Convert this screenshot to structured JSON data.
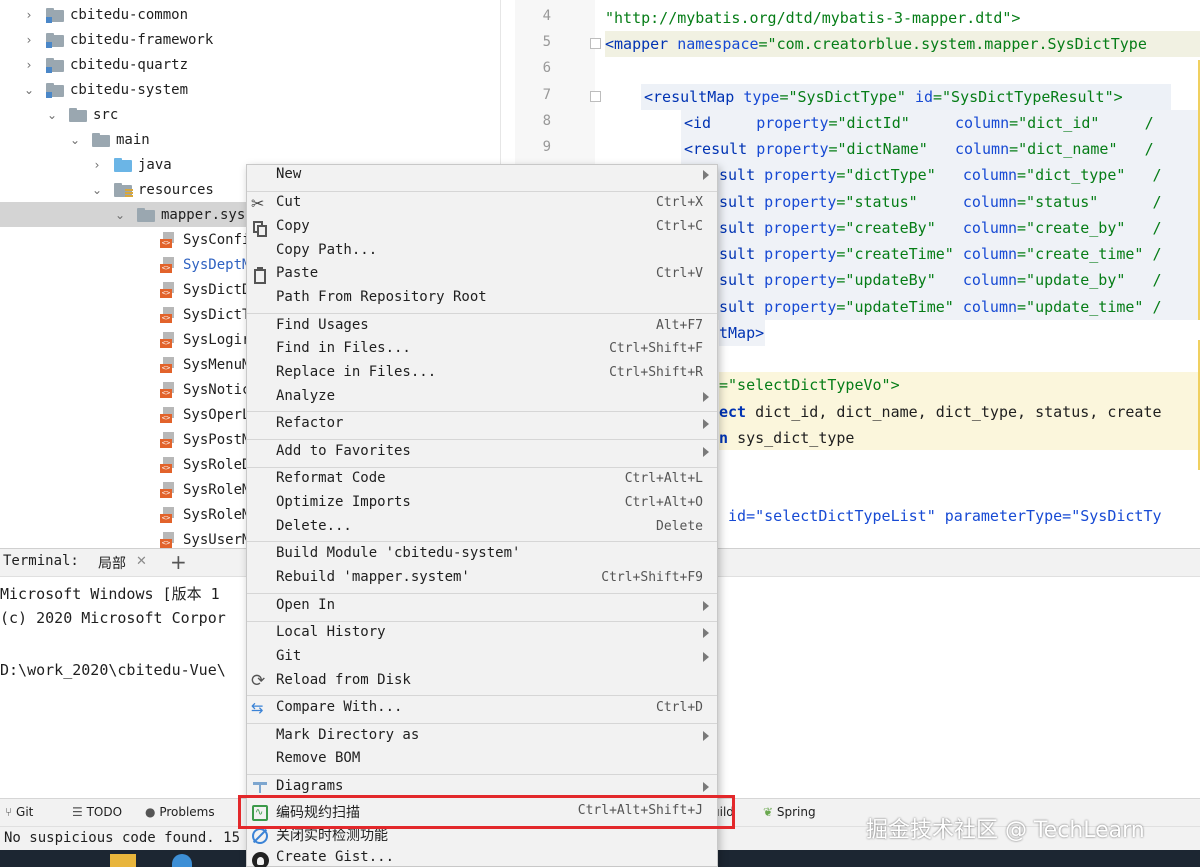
{
  "tree": {
    "items": [
      {
        "label": "cbitedu-common",
        "kind": "module",
        "expanded": false
      },
      {
        "label": "cbitedu-framework",
        "kind": "module",
        "expanded": false
      },
      {
        "label": "cbitedu-quartz",
        "kind": "module",
        "expanded": false
      },
      {
        "label": "cbitedu-system",
        "kind": "module",
        "expanded": true
      },
      {
        "label": "src",
        "kind": "folder",
        "expanded": true
      },
      {
        "label": "main",
        "kind": "folder",
        "expanded": true
      },
      {
        "label": "java",
        "kind": "source",
        "expanded": false
      },
      {
        "label": "resources",
        "kind": "resources",
        "expanded": true
      },
      {
        "label": "mapper.syst",
        "kind": "folder",
        "expanded": true
      },
      {
        "label": "SysConfi"
      },
      {
        "label": "SysDeptM"
      },
      {
        "label": "SysDictD"
      },
      {
        "label": "SysDictT"
      },
      {
        "label": "SysLogir"
      },
      {
        "label": "SysMenuM"
      },
      {
        "label": "SysNotic"
      },
      {
        "label": "SysOperL"
      },
      {
        "label": "SysPostM"
      },
      {
        "label": "SysRoleD"
      },
      {
        "label": "SysRoleM"
      },
      {
        "label": "SysRoleM"
      },
      {
        "label": "SysUserM"
      }
    ]
  },
  "editor": {
    "line_numbers": [
      "4",
      "5",
      "6",
      "7",
      "8",
      "9"
    ],
    "lines": {
      "l4": "\"http://mybatis.org/dtd/mybatis-3-mapper.dtd\">",
      "l5a": "<mapper ",
      "l5b": "namespace",
      "l5c": "=\"com.creatorblue.system.mapper.SysDictType",
      "l7a": "<resultMap ",
      "l7b": "type",
      "l7c": "=\"SysDictType\" ",
      "l7d": "id",
      "l7e": "=\"SysDictTypeResult\">",
      "l8a": "<id     ",
      "l8b": "property",
      "l8c": "=\"dictId\"     ",
      "l8d": "column",
      "l8e": "=\"dict_id\"     /",
      "l9a": "<result ",
      "l9b": "property",
      "l9c": "=\"dictName\"   ",
      "l9d": "column",
      "l9e": "=\"dict_name\"   /",
      "r3a": "sult ",
      "r3b": "property",
      "r3c": "=\"dictType\"   ",
      "r3d": "column",
      "r3e": "=\"dict_type\"   /",
      "r4c": "=\"status\"     ",
      "r4e": "=\"status\"      /",
      "r5c": "=\"createBy\"   ",
      "r5e": "=\"create_by\"   /",
      "r6c": "=\"createTime\" ",
      "r6e": "=\"create_time\" /",
      "r7c": "=\"updateBy\"   ",
      "r7e": "=\"update_by\"   /",
      "r8c": "=\"updateTime\" ",
      "r8e": "=\"update_time\" /",
      "end_map": "tMap>",
      "sql_id": "=\"selectDictTypeVo\">",
      "sel_kw": "ect ",
      "sel_rest": "dict_id, dict_name, dict_type, status, create",
      "from_kw": "n ",
      "from_rest": "sys_dict_type",
      "partial": " id=\"selectDictTypeList\" parameterType=\"SysDictTy"
    }
  },
  "terminal": {
    "title": "Terminal:",
    "tab": "局部",
    "lines": [
      "Microsoft Windows [版本 1",
      "(c) 2020 Microsoft Corpor",
      "",
      "D:\\work_2020\\cbitedu-Vue\\"
    ]
  },
  "toolbar": {
    "git": "Git",
    "todo": "TODO",
    "problems": "Problems",
    "build_partial": "uild",
    "spring": "Spring"
  },
  "statusbar": {
    "message": "No suspicious code found. 15 f"
  },
  "watermark": "掘金技术社区 @ TechLearn",
  "menu": {
    "items": [
      {
        "label": "New",
        "shortcut": "",
        "submenu": true,
        "icon": ""
      },
      {
        "label": "Cut",
        "shortcut": "Ctrl+X",
        "submenu": false,
        "icon": "scissors-icon"
      },
      {
        "label": "Copy",
        "shortcut": "Ctrl+C",
        "submenu": false,
        "icon": "copy-icon"
      },
      {
        "label": "Copy Path...",
        "shortcut": "",
        "submenu": false,
        "icon": ""
      },
      {
        "label": "Paste",
        "shortcut": "Ctrl+V",
        "submenu": false,
        "icon": "paste-icon"
      },
      {
        "label": "Path From Repository Root",
        "shortcut": "",
        "submenu": false,
        "icon": ""
      },
      {
        "label": "Find Usages",
        "shortcut": "Alt+F7",
        "submenu": false,
        "icon": ""
      },
      {
        "label": "Find in Files...",
        "shortcut": "Ctrl+Shift+F",
        "submenu": false,
        "icon": ""
      },
      {
        "label": "Replace in Files...",
        "shortcut": "Ctrl+Shift+R",
        "submenu": false,
        "icon": ""
      },
      {
        "label": "Analyze",
        "shortcut": "",
        "submenu": true,
        "icon": ""
      },
      {
        "label": "Refactor",
        "shortcut": "",
        "submenu": true,
        "icon": ""
      },
      {
        "label": "Add to Favorites",
        "shortcut": "",
        "submenu": true,
        "icon": ""
      },
      {
        "label": "Reformat Code",
        "shortcut": "Ctrl+Alt+L",
        "submenu": false,
        "icon": ""
      },
      {
        "label": "Optimize Imports",
        "shortcut": "Ctrl+Alt+O",
        "submenu": false,
        "icon": ""
      },
      {
        "label": "Delete...",
        "shortcut": "Delete",
        "submenu": false,
        "icon": ""
      },
      {
        "label": "Build Module 'cbitedu-system'",
        "shortcut": "",
        "submenu": false,
        "icon": ""
      },
      {
        "label": "Rebuild 'mapper.system'",
        "shortcut": "Ctrl+Shift+F9",
        "submenu": false,
        "icon": ""
      },
      {
        "label": "Open In",
        "shortcut": "",
        "submenu": true,
        "icon": ""
      },
      {
        "label": "Local History",
        "shortcut": "",
        "submenu": true,
        "icon": ""
      },
      {
        "label": "Git",
        "shortcut": "",
        "submenu": true,
        "icon": ""
      },
      {
        "label": "Reload from Disk",
        "shortcut": "",
        "submenu": false,
        "icon": "reload-icon"
      },
      {
        "label": "Compare With...",
        "shortcut": "Ctrl+D",
        "submenu": false,
        "icon": "compare-icon"
      },
      {
        "label": "Mark Directory as",
        "shortcut": "",
        "submenu": true,
        "icon": ""
      },
      {
        "label": "Remove BOM",
        "shortcut": "",
        "submenu": false,
        "icon": ""
      },
      {
        "label": "Diagrams",
        "shortcut": "",
        "submenu": true,
        "icon": "diagram-icon"
      },
      {
        "label": "编码规约扫描",
        "shortcut": "Ctrl+Alt+Shift+J",
        "submenu": false,
        "icon": "scan-icon"
      },
      {
        "label": "关闭实时检测功能",
        "shortcut": "",
        "submenu": false,
        "icon": "detect-off-icon"
      },
      {
        "label": "Create Gist...",
        "shortcut": "",
        "submenu": false,
        "icon": "github-icon"
      }
    ]
  },
  "colors": {
    "highlight_box": "#e3282b",
    "menu_bg": "#f2f2f2",
    "xml_tag": "#0033b3",
    "xml_string": "#067d17"
  }
}
